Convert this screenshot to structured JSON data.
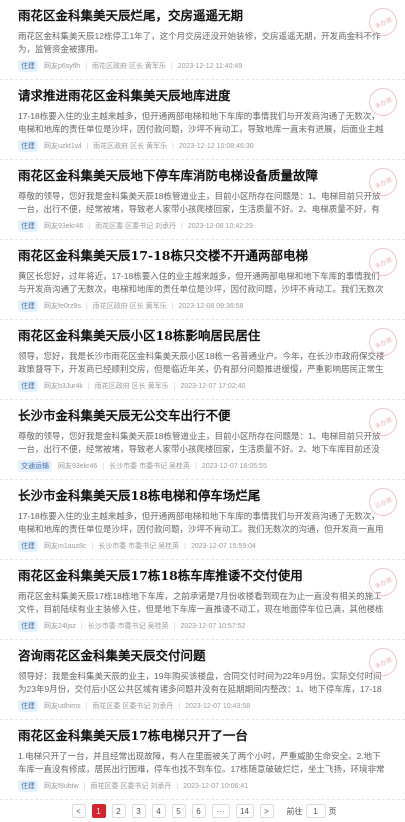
{
  "items": [
    {
      "title": "雨花区金科集美天辰烂尾，交房遥遥无期",
      "summary": "雨花区金科集美天辰12栋停工1年了，这个月交房还没开始装修，交房遥遥无期，开发商金科不作为，监管资金被挪用。",
      "tag": "住建",
      "user": "网友p6syflh",
      "dept": "雨花区政府 区长 黄军乐",
      "time": "2023-12-12 11:40:49",
      "stamp": "未办理"
    },
    {
      "title": "请求推进雨花区金科集美天辰地库进度",
      "summary": "17-18栋要入住的业主越来越多，但开通两部电梯和地下车库的事情我们与开发商沟通了无数次，电梯和地库的责任单位是沙坪，因付款问题，沙坪不肯动工，导致地库一直未有进展，后面业主越来越多，停车都不方便。",
      "tag": "住建",
      "user": "网友uzkt1wl",
      "dept": "雨花区政府 区长 黄军乐",
      "time": "2023-12-12 10:08:46:30",
      "stamp": "未办理"
    },
    {
      "title": "雨花区金科集美天辰地下停车库消防电梯设备质量故障",
      "summary": "尊敬的领导，您好我是金科集美天辰18栋管道业主，目前小区所存在问题是：1、电梯目前只开放一台，出行不便，经常被堵，导致老人家带小孩爬楼回家，生活质量不好。2、电梯质量不好，有很这类业主从高楼层掉到负一楼，",
      "tag": "住建",
      "user": "网友93ekr46",
      "dept": "雨花区委 区委书记 刘承丹",
      "time": "2023-12-08 10:42:29",
      "stamp": "未办理"
    },
    {
      "title": "雨花区金科集美天辰17-18栋只交楼不开通两部电梯",
      "summary": "黄区长您好，过年将近，17-18栋要入住的业主越来越多，但开通两部电梯和地下车库的事情我们与开发商沟通了无数次，电梯和地库的责任单位是沙坪，因付款问题，沙坪不肯动工。我们无数次的沟通，但开发商一直",
      "tag": "住建",
      "user": "网友fe0rz9s",
      "dept": "雨花区政府 区长 黄军乐",
      "time": "2023-12-08 09:36:58",
      "stamp": "未办理"
    },
    {
      "title": "雨花区金科集美天辰小区18栋影响居民居住",
      "summary": "领导，您好，我是长沙市雨花区金科集美天辰小区18栋一名普通业户。今年，在长沙市政府保交楼政策督导下，开发商已经顺利交房，但是临近年关，仍有部分问题推进缓慢，严重影响居民正常生活，具体如下：1、",
      "tag": "住建",
      "user": "网友b3Jur4k",
      "dept": "雨花区政府 区长 黄军乐",
      "time": "2023-12-07 17:02:40",
      "stamp": "未办理"
    },
    {
      "title": "长沙市金科集美天辰无公交车出行不便",
      "summary": "尊敬的领导，您好我是金科集美天辰18栋管道业主，目前小区所存在问题是：1、电梯目前只开放一台，出行不便，经常被堵，导致老人家带小孩爬楼回家，生活质量不好。2、地下车库目前还没开放，导致17-18栋业",
      "tag": "交通运输",
      "user": "网友93ekr46",
      "dept": "长沙市委 市委书记 吴桂英",
      "time": "2023-12-07 16:05:55",
      "stamp": "未办理"
    },
    {
      "title": "长沙市金科集美天辰18栋电梯和停车场烂尾",
      "summary": "17-18栋要入住的业主越来越多，但开通两部电梯和地下车库的事情我们与开发商沟通了无数次，电梯和地库的责任单位是沙坪，因付款问题，沙坪不肯动工。我们无数次的沟通，但开发商一直用各种理由搪塞我们，麻",
      "tag": "住建",
      "user": "网友m1auz8c",
      "dept": "长沙市委 市委书记 吴桂英",
      "time": "2023-12-07 15:59:04",
      "stamp": "已办理"
    },
    {
      "title": "雨花区金科集美天辰17栋18栋车库推诿不交付使用",
      "summary": "雨花区金科集美天辰17栋18栋地下车库，之前承诺是7月份收楼看到现在为止一直没有相关的施工文件，目前陆续有业主装修入住，但是地下车库一直推诿不动工，现在地面停车位已满，其他楼栋目前地下停车场也已",
      "tag": "住建",
      "user": "网友24ljsz",
      "dept": "长沙市委 市委书记 吴桂英",
      "time": "2023-12-07 10:57:52",
      "stamp": "未办理"
    },
    {
      "title": "咨询雨花区金科集美天辰交付问题",
      "summary": "领导好：我是金科集美天辰的业主，19年购买该楼盘，合同交付时间为22年9月份。实际交付时间为23年9月份，交付后小区公共区域有诸多问题并没有在延期期间内整改：1、地下停车库，17-18栋的业主现在入住后",
      "tag": "住建",
      "user": "网友udhims",
      "dept": "雨花区委 区委书记 刘承丹",
      "time": "2023-12-07 10:43:58",
      "stamp": "未办理"
    },
    {
      "title": "雨花区金科集美天辰17栋电梯只开了一台",
      "summary": "1.电梯只开了一台，并且经常出现故障，有人在里面被关了两个小时，严重威胁生命安全。2.地下车库一直没有修成，居民出行困难，停车也找不到车位。17栋随意破破烂烂，坐土飞扬，环境非常糟糕！",
      "tag": "住建",
      "user": "网友f8ubtw",
      "dept": "雨花区委 区委书记 刘承丹",
      "time": "2023-12-07 10:06:41",
      "stamp": ""
    }
  ],
  "pager": {
    "prev": "<",
    "pages": [
      "1",
      "2",
      "3",
      "4",
      "5",
      "6",
      "···",
      "14"
    ],
    "next": ">",
    "goto_label": "前往",
    "goto_value": "1",
    "page_unit": "页"
  }
}
